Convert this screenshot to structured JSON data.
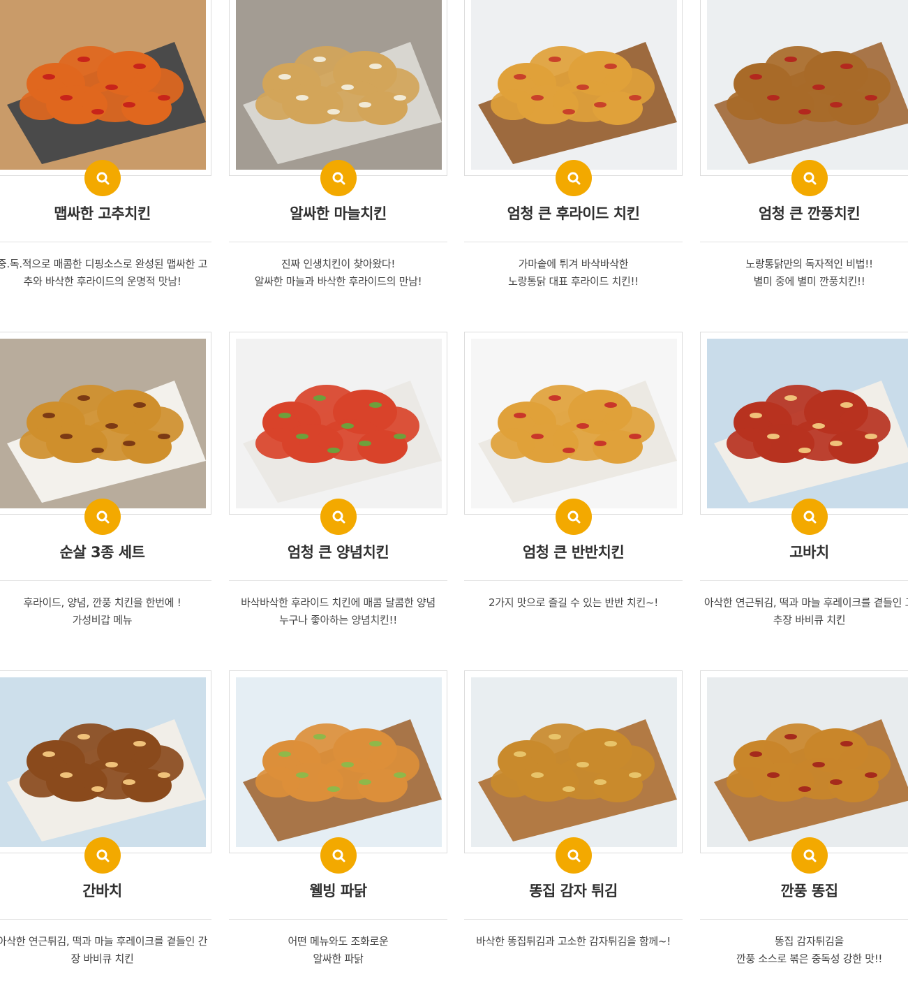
{
  "menu": [
    {
      "title": "맵싸한 고추치킨",
      "desc": "중.독.적으로 매콤한 디핑소스로 완성된 맵싸한 고추와 바삭한 후라이드의 운명적 맛남!",
      "photo": {
        "bg": "#c99b69",
        "plate": "#4a4a4a",
        "food": "#e0671e",
        "accent": "#c8241a"
      }
    },
    {
      "title": "알싸한 마늘치킨",
      "desc": "진짜 인생치킨이 찾아왔다!\n알싸한 마늘과 바삭한 후라이드의 만남!",
      "photo": {
        "bg": "#a39c93",
        "plate": "#d8d6d0",
        "food": "#d3a559",
        "accent": "#f1ead6"
      }
    },
    {
      "title": "엄청 큰 후라이드 치킨",
      "desc": "가마솥에 튀겨 바삭바삭한\n노랑통닭 대표 후라이드 치킨!!",
      "photo": {
        "bg": "#eef0f2",
        "plate": "#9d6a3e",
        "food": "#e0a13a",
        "accent": "#c9412a"
      }
    },
    {
      "title": "엄청 큰 깐풍치킨",
      "desc": "노랑통닭만의 독자적인 비법!!\n별미 중에 별미 깐풍치킨!!",
      "photo": {
        "bg": "#eceff1",
        "plate": "#a87548",
        "food": "#a86a28",
        "accent": "#b3281e"
      }
    },
    {
      "title": "순살 3종 세트",
      "desc": "후라이드, 양념, 깐풍 치킨을 한번에 !\n가성비갑 메뉴",
      "photo": {
        "bg": "#b8ac9c",
        "plate": "#f3f1ec",
        "food": "#cf8f2c",
        "accent": "#7c3a14"
      }
    },
    {
      "title": "엄청 큰 양념치킨",
      "desc": "바삭바삭한 후라이드 치킨에 매콤 달콤한 양념\n누구나 좋아하는 양념치킨!!",
      "photo": {
        "bg": "#f2f2f2",
        "plate": "#ebe9e5",
        "food": "#d9432a",
        "accent": "#6ea03c"
      }
    },
    {
      "title": "엄청 큰 반반치킨",
      "desc": "2가지 맛으로 즐길 수 있는 반반 치킨~!",
      "photo": {
        "bg": "#f6f6f6",
        "plate": "#ece9e3",
        "food": "#e0a13a",
        "accent": "#c9362a"
      }
    },
    {
      "title": "고바치",
      "desc": "아삭한 연근튀김, 떡과 마늘 후레이크를 곁들인 고추장 바비큐 치킨",
      "photo": {
        "bg": "#c9dcea",
        "plate": "#f1eee8",
        "food": "#b7321f",
        "accent": "#f0c27a"
      }
    },
    {
      "title": "간바치",
      "desc": "아삭한 연근튀김, 떡과 마늘 후레이크를 곁들인 간장 바비큐 치킨",
      "photo": {
        "bg": "#cddfeb",
        "plate": "#f1eee8",
        "food": "#8a4a1c",
        "accent": "#f0c27a"
      }
    },
    {
      "title": "웰빙 파닭",
      "desc": "어떤 메뉴와도 조화로운\n알싸한 파닭",
      "photo": {
        "bg": "#e5eef4",
        "plate": "#a87548",
        "food": "#dc8f3a",
        "accent": "#8fb84a"
      }
    },
    {
      "title": "똥집 감자 튀김",
      "desc": "바삭한 똥집튀김과 고소한 감자튀김을 함께~!",
      "photo": {
        "bg": "#e9eef1",
        "plate": "#b27a44",
        "food": "#c98a2c",
        "accent": "#e8c46a"
      }
    },
    {
      "title": "깐풍 똥집",
      "desc": "똥집 감자튀김을\n깐풍 소스로 볶은 중독성 강한 맛!!",
      "photo": {
        "bg": "#e8ecee",
        "plate": "#b27a44",
        "food": "#c9862a",
        "accent": "#a52a1c"
      }
    }
  ]
}
